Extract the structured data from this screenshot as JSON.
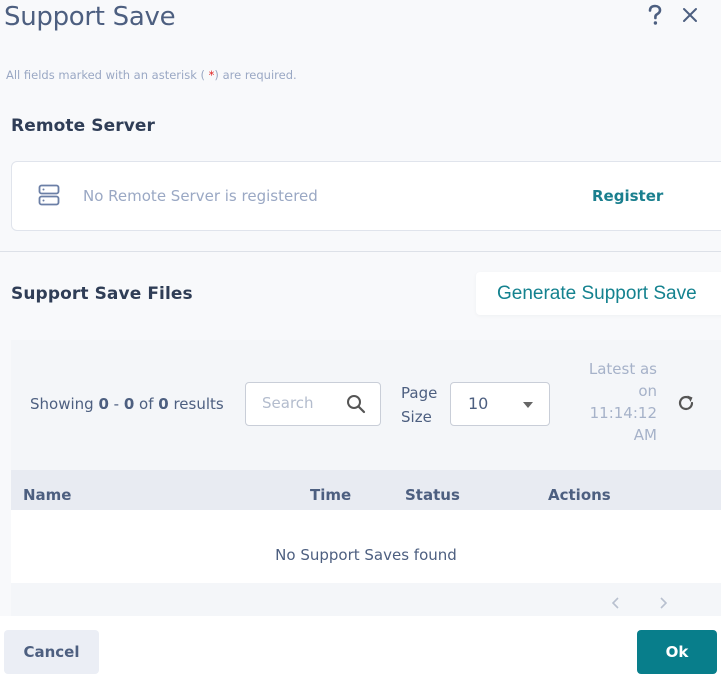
{
  "dialog": {
    "title": "Support Save",
    "help_icon": "question-mark-icon",
    "close_icon": "close-icon",
    "required_note_prefix": "All fields marked with an asterisk ( ",
    "required_note_star": "*",
    "required_note_suffix": ") are required."
  },
  "remote_server": {
    "section_title": "Remote Server",
    "icon": "server-icon",
    "status_text": "No Remote Server is registered",
    "register_label": "Register"
  },
  "support_save_files": {
    "section_title": "Support Save Files",
    "generate_label": "Generate Support Save",
    "showing": {
      "prefix": "Showing ",
      "from": "0",
      "sep": " - ",
      "to": "0",
      "of": " of ",
      "total": "0",
      "suffix": " results"
    },
    "search": {
      "placeholder": "Search",
      "value": "",
      "icon": "search-icon"
    },
    "page_size": {
      "label_line1": "Page",
      "label_line2": "Size",
      "value": "10",
      "icon": "caret-down-icon"
    },
    "latest": {
      "line1": "Latest as",
      "line2": "on",
      "line3": "11:14:12",
      "line4": "AM"
    },
    "refresh_icon": "refresh-icon",
    "columns": [
      "Name",
      "Time",
      "Status",
      "Actions"
    ],
    "rows": [],
    "empty_message": "No Support Saves found",
    "pager": {
      "prev_icon": "chevron-left-icon",
      "next_icon": "chevron-right-icon"
    }
  },
  "footer": {
    "cancel_label": "Cancel",
    "ok_label": "Ok"
  },
  "colors": {
    "accent": "#087e8b",
    "link": "#1a7f8e",
    "required_star": "#e02020",
    "background": "#f8f9fb"
  }
}
